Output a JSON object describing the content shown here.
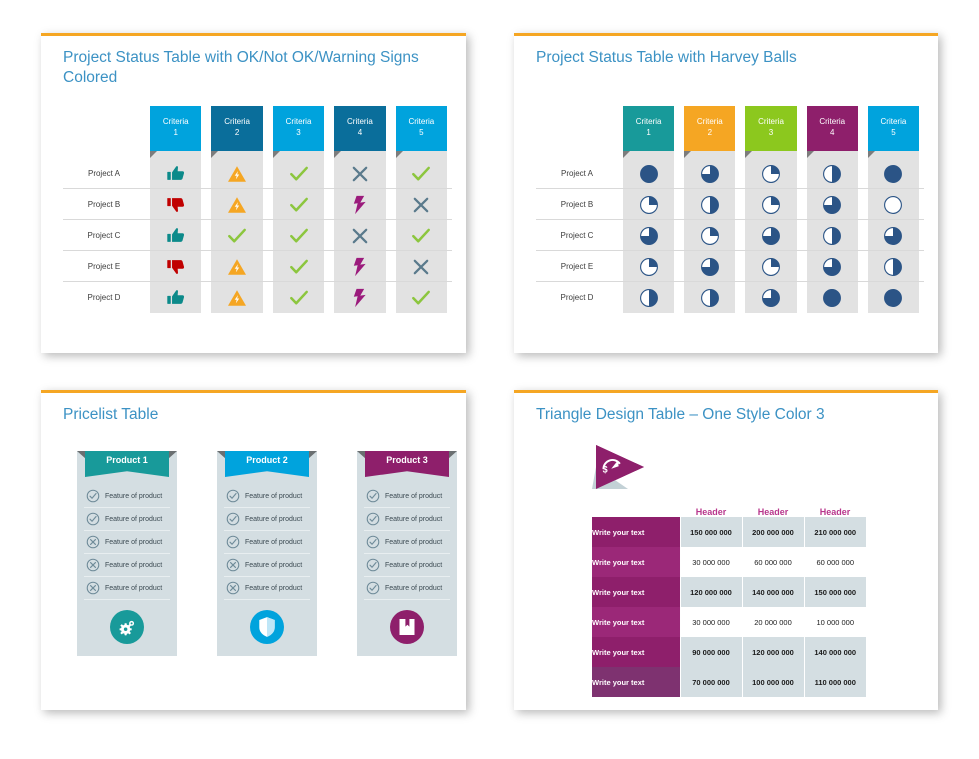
{
  "theme": {
    "accent_top_bar": "#F5A623",
    "title_color": "#3C92C4",
    "cell_bg": "#E2E2E2",
    "harvey_blue": "#2B5486",
    "price_card_bg": "#D4DEE2",
    "magenta": "#8E1F6B"
  },
  "panels": {
    "status_signs": {
      "title": "Project Status Table with OK/Not OK/Warning Signs Colored",
      "criteria": [
        {
          "label": "Criteria",
          "num": "1",
          "color": "#00A3DD"
        },
        {
          "label": "Criteria",
          "num": "2",
          "color": "#0A6E9B"
        },
        {
          "label": "Criteria",
          "num": "3",
          "color": "#00A3DD"
        },
        {
          "label": "Criteria",
          "num": "4",
          "color": "#0A6E9B"
        },
        {
          "label": "Criteria",
          "num": "5",
          "color": "#00A3DD"
        }
      ],
      "rows": [
        {
          "label": "Project A",
          "cells": [
            "thumbs-up-icon",
            "warning-icon",
            "check-icon",
            "cross-icon",
            "check-icon"
          ]
        },
        {
          "label": "Project B",
          "cells": [
            "thumbs-down-icon",
            "warning-icon",
            "check-icon",
            "bolt-icon",
            "cross-icon"
          ]
        },
        {
          "label": "Project C",
          "cells": [
            "thumbs-up-icon",
            "check-icon",
            "check-icon",
            "cross-icon",
            "check-icon"
          ]
        },
        {
          "label": "Project E",
          "cells": [
            "thumbs-down-icon",
            "warning-icon",
            "check-icon",
            "bolt-icon",
            "cross-icon"
          ]
        },
        {
          "label": "Project D",
          "cells": [
            "thumbs-up-icon",
            "warning-icon",
            "check-icon",
            "bolt-icon",
            "check-icon"
          ]
        }
      ],
      "icon_colors": {
        "thumbs-up-icon": "#0C8A8A",
        "thumbs-down-icon": "#C00000",
        "warning-icon": "#F5A623",
        "check-icon": "#8CC63E",
        "cross-icon": "#5A7A8C",
        "bolt-icon": "#9B1B7C"
      }
    },
    "harvey_balls": {
      "title": "Project Status Table with Harvey Balls",
      "criteria": [
        {
          "label": "Criteria",
          "num": "1",
          "color": "#189A9A"
        },
        {
          "label": "Criteria",
          "num": "2",
          "color": "#F5A623"
        },
        {
          "label": "Criteria",
          "num": "3",
          "color": "#8CC81E"
        },
        {
          "label": "Criteria",
          "num": "4",
          "color": "#8E1F6B"
        },
        {
          "label": "Criteria",
          "num": "5",
          "color": "#00A3DD"
        }
      ],
      "rows": [
        {
          "label": "Project A",
          "fill": [
            100,
            75,
            25,
            50,
            100
          ]
        },
        {
          "label": "Project B",
          "fill": [
            25,
            50,
            25,
            75,
            0
          ]
        },
        {
          "label": "Project C",
          "fill": [
            75,
            25,
            75,
            50,
            75
          ]
        },
        {
          "label": "Project E",
          "fill": [
            25,
            75,
            25,
            75,
            50
          ]
        },
        {
          "label": "Project D",
          "fill": [
            50,
            50,
            75,
            100,
            100
          ]
        }
      ]
    },
    "pricelist": {
      "title": "Pricelist Table",
      "feature_label": "Feature of product",
      "cards": [
        {
          "name": "Product 1",
          "color": "#189A9A",
          "badge_icon": "gears-icon",
          "features": [
            "check",
            "check",
            "cross",
            "cross",
            "cross"
          ]
        },
        {
          "name": "Product 2",
          "color": "#00A3DD",
          "badge_icon": "shield-icon",
          "features": [
            "check",
            "check",
            "check",
            "cross",
            "cross"
          ]
        },
        {
          "name": "Product 3",
          "color": "#8E1F6B",
          "badge_icon": "book-icon",
          "features": [
            "check",
            "check",
            "check",
            "check",
            "check"
          ]
        }
      ]
    },
    "triangle_table": {
      "title": "Triangle Design Table – One Style Color 3",
      "flag_icon": "dollar-gauge-icon",
      "flag_color": "#8E1F6B",
      "headers": [
        "Header",
        "Header",
        "Header"
      ],
      "rows": [
        {
          "label": "Write your text",
          "values": [
            "150 000 000",
            "200 000 000",
            "210 000 000"
          ],
          "shaded": true,
          "bold": true
        },
        {
          "label": "Write your text",
          "values": [
            "30 000 000",
            "60 000 000",
            "60 000 000"
          ],
          "shaded": false,
          "bold": false
        },
        {
          "label": "Write your text",
          "values": [
            "120 000 000",
            "140 000 000",
            "150 000 000"
          ],
          "shaded": true,
          "bold": true
        },
        {
          "label": "Write your text",
          "values": [
            "30 000 000",
            "20 000 000",
            "10 000 000"
          ],
          "shaded": false,
          "bold": false
        },
        {
          "label": "Write your text",
          "values": [
            "90 000 000",
            "120 000 000",
            "140 000 000"
          ],
          "shaded": true,
          "bold": true
        },
        {
          "label": "Write your text",
          "values": [
            "70 000 000",
            "100 000 000",
            "110 000 000"
          ],
          "shaded": true,
          "bold": true
        }
      ],
      "label_colors": [
        "#8E1F6B",
        "#9B2878",
        "#8E1F6B",
        "#9B2878",
        "#8E1F6B",
        "#7E3270"
      ]
    }
  }
}
